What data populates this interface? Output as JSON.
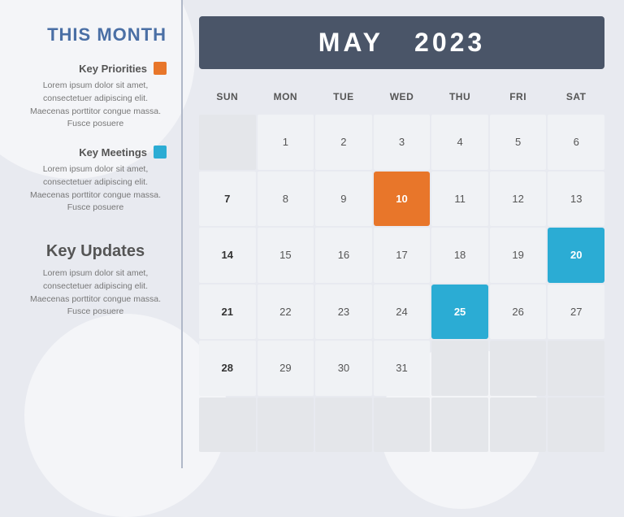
{
  "sidebar": {
    "title": "THIS MONTH",
    "priorities_label": "Key Priorities",
    "priorities_color": "orange",
    "priorities_text": "Lorem ipsum dolor sit amet, consectetuer adipiscing elit. Maecenas porttitor congue massa. Fusce posuere",
    "meetings_label": "Key Meetings",
    "meetings_color": "blue",
    "meetings_text": "Lorem ipsum dolor sit amet, consectetuer adipiscing elit. Maecenas porttitor congue massa. Fusce posuere",
    "updates_title": "Key Updates",
    "updates_text": "Lorem ipsum dolor sit amet, consectetuer adipiscing elit. Maecenas porttitor congue massa. Fusce posuere"
  },
  "calendar": {
    "header_month": "MAY",
    "header_year": "2023",
    "days_of_week": [
      "SUN",
      "MON",
      "TUE",
      "WED",
      "THU",
      "FRI",
      "SAT"
    ],
    "weeks": [
      [
        {
          "date": "",
          "type": "empty"
        },
        {
          "date": "1",
          "type": "normal"
        },
        {
          "date": "2",
          "type": "normal"
        },
        {
          "date": "3",
          "type": "normal"
        },
        {
          "date": "4",
          "type": "normal"
        },
        {
          "date": "5",
          "type": "normal"
        },
        {
          "date": "6",
          "type": "normal"
        }
      ],
      [
        {
          "date": "7",
          "type": "bold"
        },
        {
          "date": "8",
          "type": "normal"
        },
        {
          "date": "9",
          "type": "normal"
        },
        {
          "date": "10",
          "type": "highlight-orange"
        },
        {
          "date": "11",
          "type": "normal"
        },
        {
          "date": "12",
          "type": "normal"
        },
        {
          "date": "13",
          "type": "normal"
        }
      ],
      [
        {
          "date": "14",
          "type": "bold"
        },
        {
          "date": "15",
          "type": "normal"
        },
        {
          "date": "16",
          "type": "normal"
        },
        {
          "date": "17",
          "type": "normal"
        },
        {
          "date": "18",
          "type": "normal"
        },
        {
          "date": "19",
          "type": "normal"
        },
        {
          "date": "20",
          "type": "highlight-blue"
        }
      ],
      [
        {
          "date": "21",
          "type": "bold"
        },
        {
          "date": "22",
          "type": "normal"
        },
        {
          "date": "23",
          "type": "normal"
        },
        {
          "date": "24",
          "type": "normal"
        },
        {
          "date": "25",
          "type": "highlight-blue"
        },
        {
          "date": "26",
          "type": "normal"
        },
        {
          "date": "27",
          "type": "normal"
        }
      ],
      [
        {
          "date": "28",
          "type": "bold"
        },
        {
          "date": "29",
          "type": "normal"
        },
        {
          "date": "30",
          "type": "normal"
        },
        {
          "date": "31",
          "type": "normal"
        },
        {
          "date": "",
          "type": "empty"
        },
        {
          "date": "",
          "type": "empty"
        },
        {
          "date": "",
          "type": "empty"
        }
      ],
      [
        {
          "date": "",
          "type": "empty"
        },
        {
          "date": "",
          "type": "empty"
        },
        {
          "date": "",
          "type": "empty"
        },
        {
          "date": "",
          "type": "empty"
        },
        {
          "date": "",
          "type": "empty"
        },
        {
          "date": "",
          "type": "empty"
        },
        {
          "date": "",
          "type": "empty"
        }
      ]
    ]
  }
}
